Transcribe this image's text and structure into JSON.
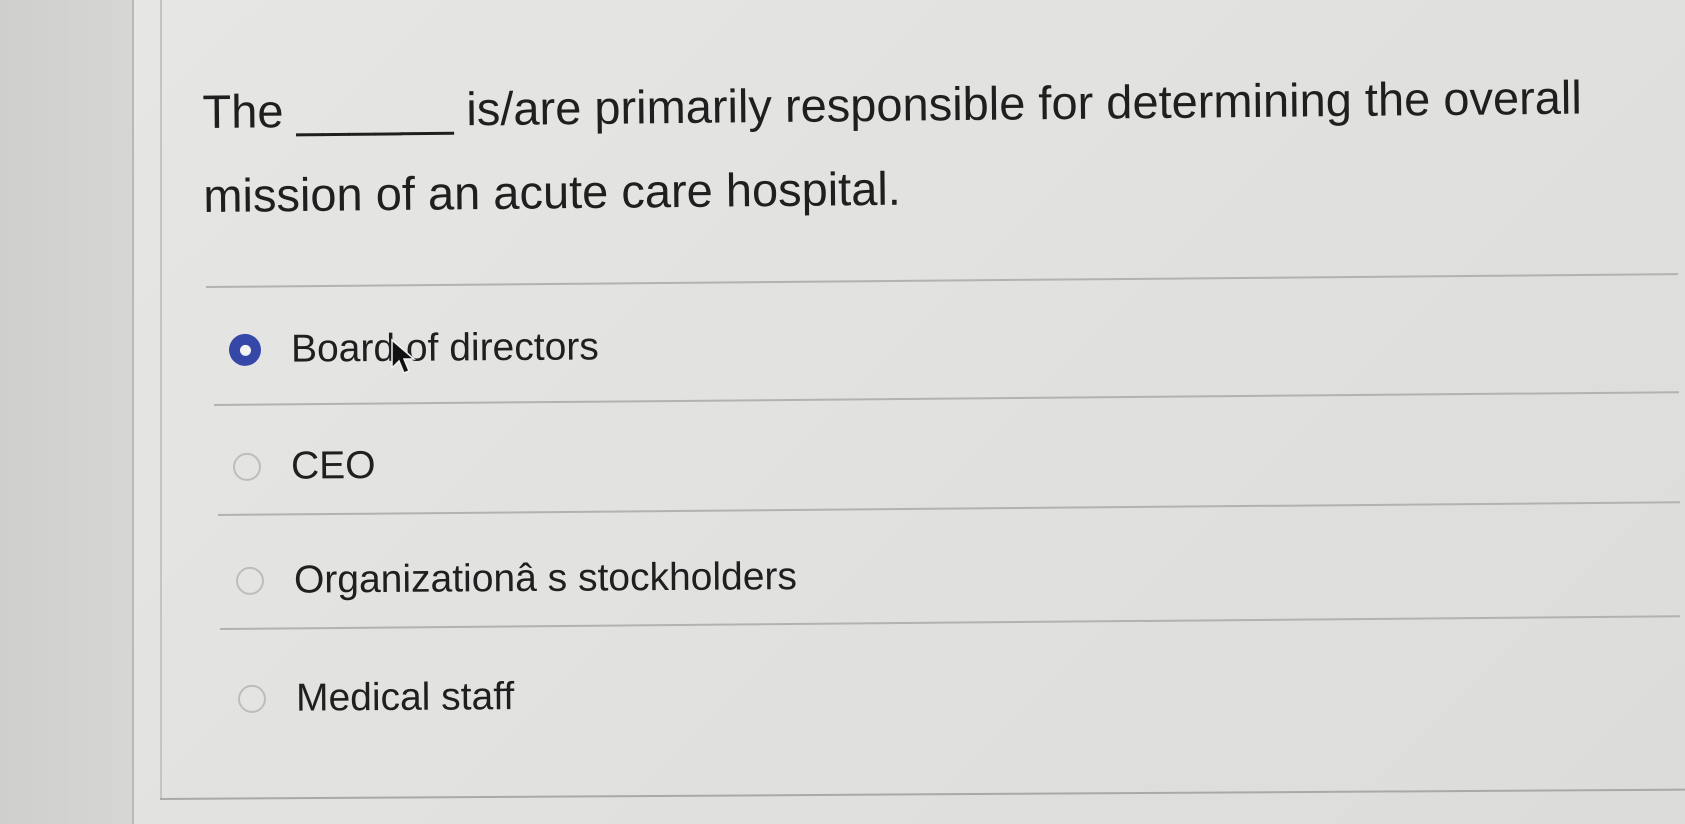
{
  "question": {
    "text": "The ______ is/are primarily responsible for determining the overall mission of an acute care hospital."
  },
  "options": [
    {
      "label": "Board of directors",
      "selected": true
    },
    {
      "label": "CEO",
      "selected": false
    },
    {
      "label": "Organizationâ s stockholders",
      "selected": false
    },
    {
      "label": "Medical staff",
      "selected": false
    }
  ],
  "colors": {
    "selected_radio": "#3548a8",
    "text": "#1f1f1f"
  },
  "icons": {
    "cursor": "mouse-pointer-icon"
  }
}
